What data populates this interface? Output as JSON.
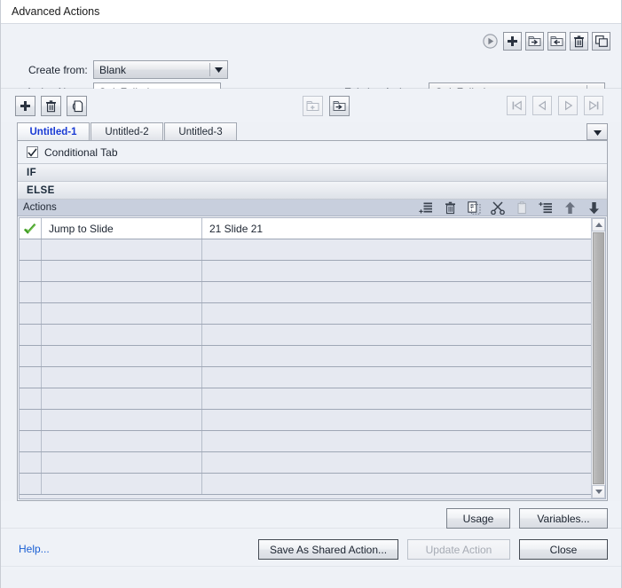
{
  "window": {
    "title": "Advanced Actions"
  },
  "top_panel": {
    "create_from_label": "Create from:",
    "create_from_value": "Blank",
    "create_from_options": [
      "Blank"
    ],
    "action_name_label": "Action Name:",
    "action_name_value": "QuizFailed",
    "action_name_placeholder": "",
    "existing_actions_label": "Existing Actions:",
    "existing_actions_value": "QuizFailed",
    "existing_actions_options": [
      "QuizFailed"
    ],
    "icons": [
      {
        "name": "preview-play-icon",
        "title": "Preview",
        "enabled": true
      },
      {
        "name": "add-action-icon",
        "title": "Create new action",
        "enabled": true
      },
      {
        "name": "export-action-icon",
        "title": "Export",
        "enabled": true
      },
      {
        "name": "import-action-icon",
        "title": "Import",
        "enabled": true
      },
      {
        "name": "delete-action-icon",
        "title": "Delete",
        "enabled": true
      },
      {
        "name": "duplicate-action-icon",
        "title": "Duplicate",
        "enabled": true
      }
    ]
  },
  "tab_toolbar": {
    "left_icons": [
      {
        "name": "add-tab-icon",
        "title": "Add decision",
        "enabled": true
      },
      {
        "name": "delete-tab-icon",
        "title": "Remove decision",
        "enabled": true
      },
      {
        "name": "duplicate-tab-icon",
        "title": "Duplicate decision",
        "enabled": true
      }
    ],
    "mid_icons": [
      {
        "name": "save-to-library-icon",
        "title": "Save to library",
        "enabled": false
      },
      {
        "name": "open-from-library-icon",
        "title": "Open from library",
        "enabled": true
      }
    ],
    "nav_icons": [
      {
        "name": "first-tab-icon",
        "title": "First",
        "enabled": false
      },
      {
        "name": "previous-tab-icon",
        "title": "Previous",
        "enabled": false
      },
      {
        "name": "next-tab-icon",
        "title": "Next",
        "enabled": false
      },
      {
        "name": "last-tab-icon",
        "title": "Last",
        "enabled": false
      }
    ]
  },
  "tabs": {
    "items": [
      {
        "label": "Untitled-1",
        "active": true
      },
      {
        "label": "Untitled-2",
        "active": false
      },
      {
        "label": "Untitled-3",
        "active": false
      }
    ],
    "overflow_icon": "chevron-down-icon"
  },
  "conditional": {
    "checkbox_label": "Conditional Tab",
    "checkbox_checked": true,
    "if_label": "IF",
    "else_label": "ELSE"
  },
  "actions_table": {
    "header_label": "Actions",
    "header_icons": [
      {
        "name": "add-row-icon",
        "title": "Add action",
        "enabled": true
      },
      {
        "name": "delete-row-icon",
        "title": "Delete action",
        "enabled": true
      },
      {
        "name": "copy-row-icon",
        "title": "Copy action",
        "enabled": true
      },
      {
        "name": "cut-row-icon",
        "title": "Cut action",
        "enabled": true
      },
      {
        "name": "paste-row-icon",
        "title": "Paste action",
        "enabled": false
      },
      {
        "name": "insert-row-icon",
        "title": "Insert action",
        "enabled": true
      },
      {
        "name": "move-up-icon",
        "title": "Move up",
        "enabled": true
      },
      {
        "name": "move-down-icon",
        "title": "Move down",
        "enabled": true
      }
    ],
    "rows": [
      {
        "enabled": true,
        "action": "Jump to Slide",
        "target": "21 Slide 21"
      },
      {
        "enabled": false,
        "action": "",
        "target": ""
      },
      {
        "enabled": false,
        "action": "",
        "target": ""
      },
      {
        "enabled": false,
        "action": "",
        "target": ""
      },
      {
        "enabled": false,
        "action": "",
        "target": ""
      },
      {
        "enabled": false,
        "action": "",
        "target": ""
      },
      {
        "enabled": false,
        "action": "",
        "target": ""
      },
      {
        "enabled": false,
        "action": "",
        "target": ""
      },
      {
        "enabled": false,
        "action": "",
        "target": ""
      },
      {
        "enabled": false,
        "action": "",
        "target": ""
      },
      {
        "enabled": false,
        "action": "",
        "target": ""
      },
      {
        "enabled": false,
        "action": "",
        "target": ""
      },
      {
        "enabled": false,
        "action": "",
        "target": ""
      }
    ],
    "scrollbar": {
      "up_icon": "scroll-up-icon",
      "down_icon": "scroll-down-icon"
    }
  },
  "footer": {
    "usage_label": "Usage",
    "variables_label": "Variables...",
    "help_label": "Help...",
    "save_shared_label": "Save As Shared Action...",
    "update_action_label": "Update Action",
    "update_action_enabled": false,
    "close_label": "Close"
  },
  "colors": {
    "accent_link": "#1a5fd4",
    "active_tab_text": "#1a3bd4",
    "panel_bg": "#eff2f7",
    "header_bg": "#c8cfdd",
    "row_alt_bg": "#e6e9f1",
    "check_green": "#3f9c23"
  }
}
